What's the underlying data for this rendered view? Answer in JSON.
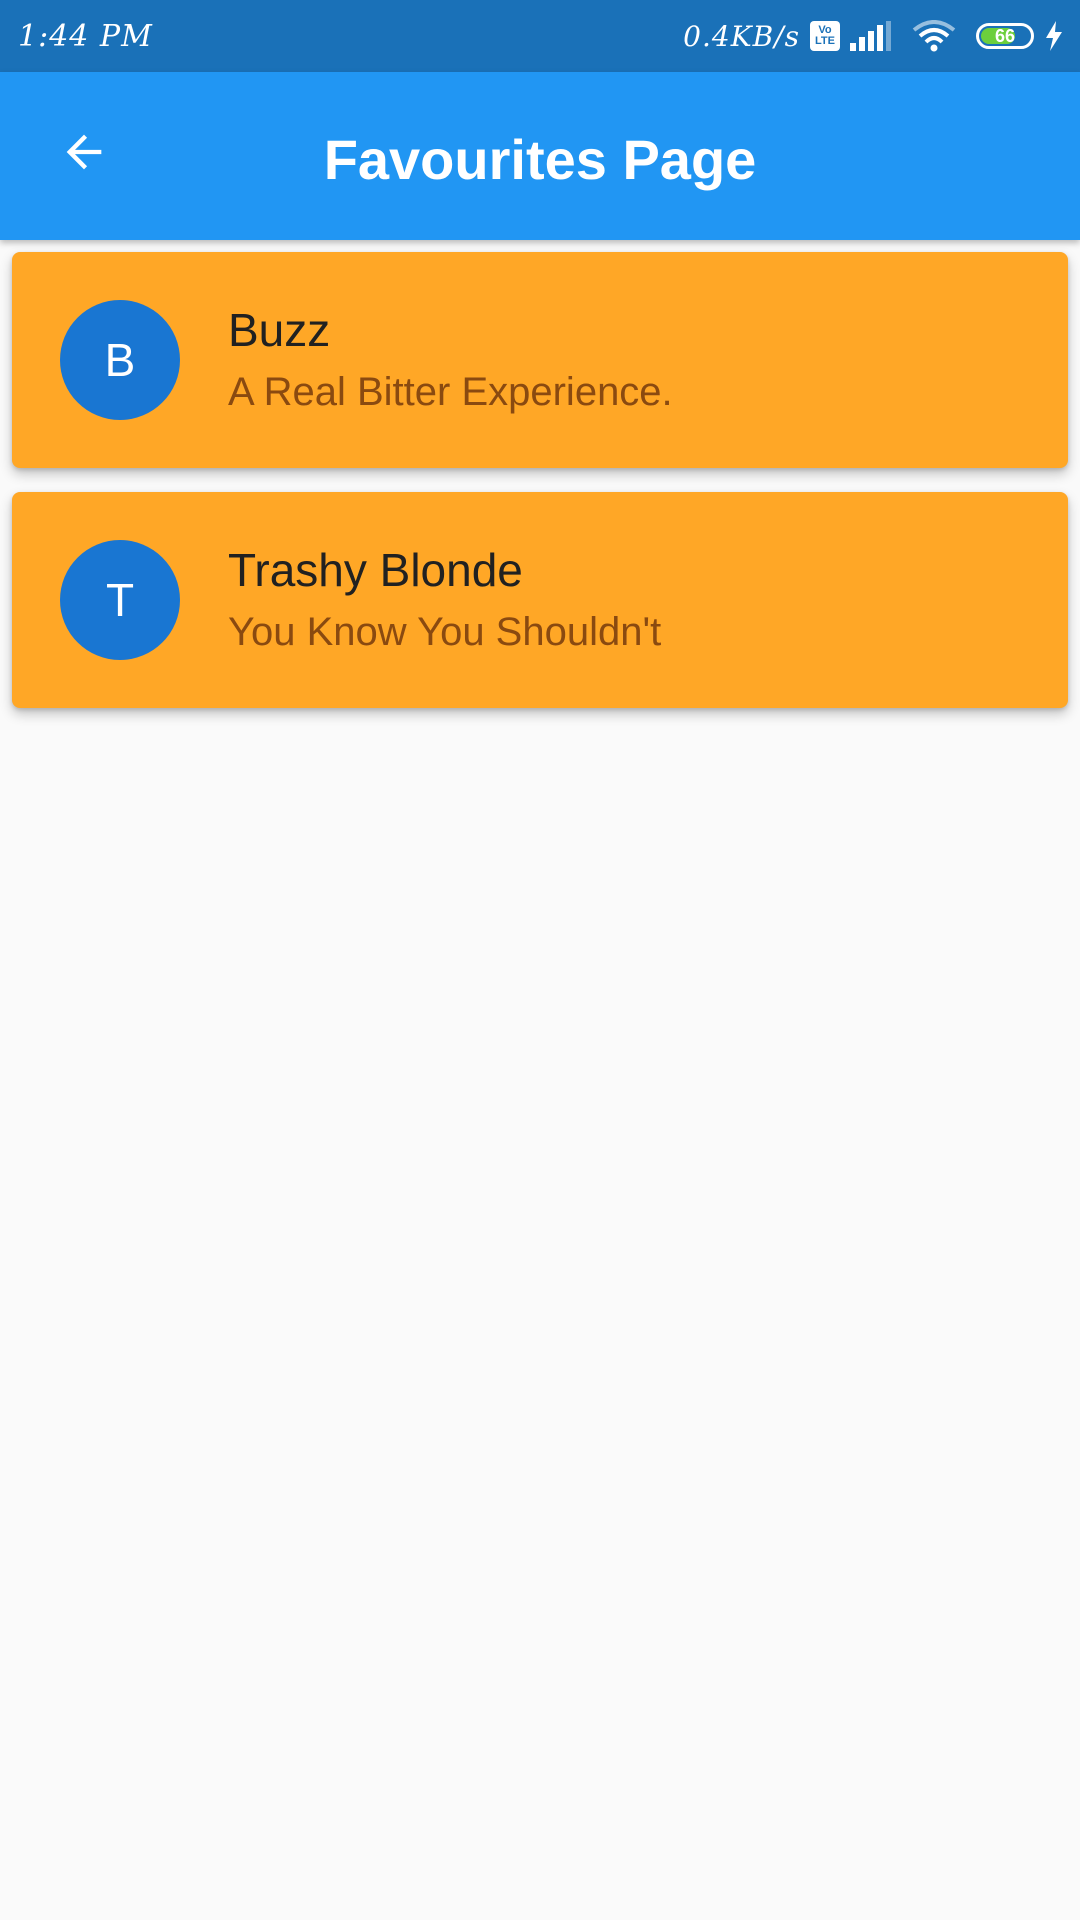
{
  "status_bar": {
    "time": "1:44 PM",
    "net_speed": "0.4KB/s",
    "volte_top": "Vo",
    "volte_bottom": "LTE",
    "battery": "66"
  },
  "app_bar": {
    "back_icon": "arrow-back-icon",
    "title": "Favourites Page",
    "color": "#2196f3"
  },
  "favourites": [
    {
      "initial": "B",
      "name": "Buzz",
      "tagline": "A Real Bitter Experience."
    },
    {
      "initial": "T",
      "name": "Trashy Blonde",
      "tagline": "You Know You Shouldn't"
    }
  ],
  "colors": {
    "card": "#ffa726",
    "avatar": "#1976d2"
  }
}
